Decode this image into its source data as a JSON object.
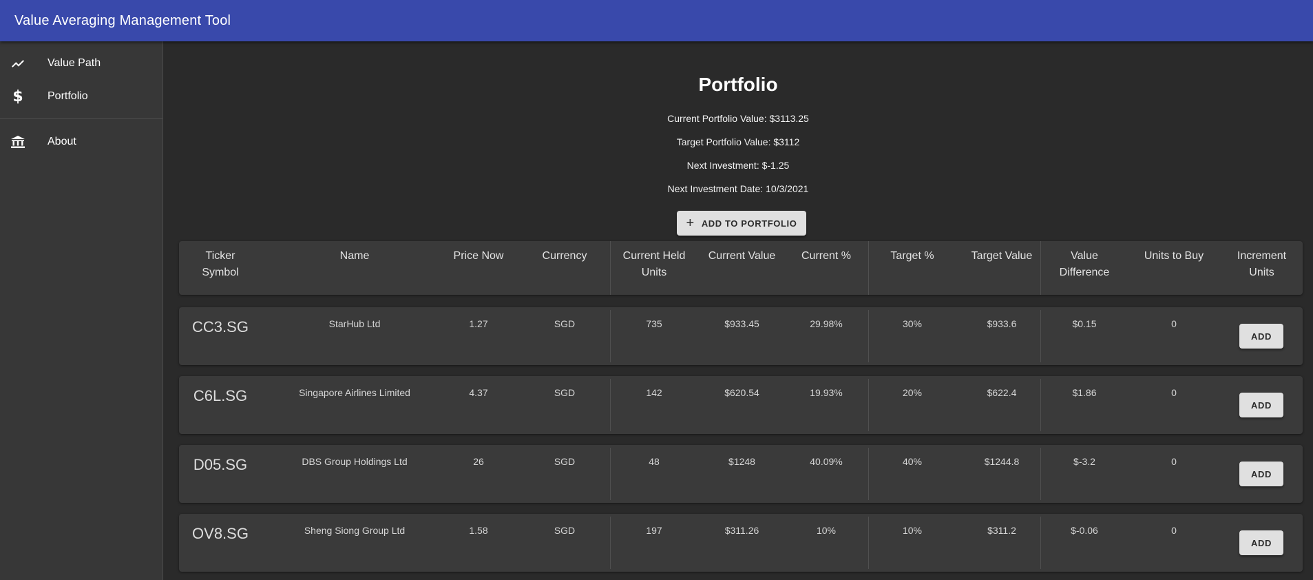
{
  "app": {
    "title": "Value Averaging Management Tool"
  },
  "nav": {
    "items": [
      {
        "label": "Value Path",
        "icon": "trending-up-icon"
      },
      {
        "label": "Portfolio",
        "icon": "dollar-icon"
      },
      {
        "label": "About",
        "icon": "bank-icon"
      }
    ]
  },
  "portfolio": {
    "title": "Portfolio",
    "current_value": "Current Portfolio Value: $3113.25",
    "target_value": "Target Portfolio Value: $3112",
    "next_investment": "Next Investment: $-1.25",
    "next_investment_date": "Next Investment Date: 10/3/2021",
    "add_button": "ADD TO PORTFOLIO",
    "add_icon": "plus-icon"
  },
  "table": {
    "headers": {
      "ticker_line1": "Ticker",
      "ticker_line2": "Symbol",
      "name": "Name",
      "price": "Price Now",
      "currency": "Currency",
      "held_line1": "Current Held",
      "held_line2": "Units",
      "current_value": "Current Value",
      "current_pct": "Current %",
      "target_pct": "Target %",
      "target_value": "Target Value",
      "diff_line1": "Value",
      "diff_line2": "Difference",
      "units_to_buy": "Units to Buy",
      "incr_line1": "Increment",
      "incr_line2": "Units"
    },
    "add_label": "ADD",
    "rows": [
      {
        "ticker": "CC3.SG",
        "name": "StarHub Ltd",
        "price": "1.27",
        "currency": "SGD",
        "held": "735",
        "current_value": "$933.45",
        "current_pct": "29.98%",
        "target_pct": "30%",
        "target_value": "$933.6",
        "diff": "$0.15",
        "units_to_buy": "0"
      },
      {
        "ticker": "C6L.SG",
        "name": "Singapore Airlines Limited",
        "price": "4.37",
        "currency": "SGD",
        "held": "142",
        "current_value": "$620.54",
        "current_pct": "19.93%",
        "target_pct": "20%",
        "target_value": "$622.4",
        "diff": "$1.86",
        "units_to_buy": "0"
      },
      {
        "ticker": "D05.SG",
        "name": "DBS Group Holdings Ltd",
        "price": "26",
        "currency": "SGD",
        "held": "48",
        "current_value": "$1248",
        "current_pct": "40.09%",
        "target_pct": "40%",
        "target_value": "$1244.8",
        "diff": "$-3.2",
        "units_to_buy": "0"
      },
      {
        "ticker": "OV8.SG",
        "name": "Sheng Siong Group Ltd",
        "price": "1.58",
        "currency": "SGD",
        "held": "197",
        "current_value": "$311.26",
        "current_pct": "10%",
        "target_pct": "10%",
        "target_value": "$311.2",
        "diff": "$-0.06",
        "units_to_buy": "0"
      }
    ]
  }
}
